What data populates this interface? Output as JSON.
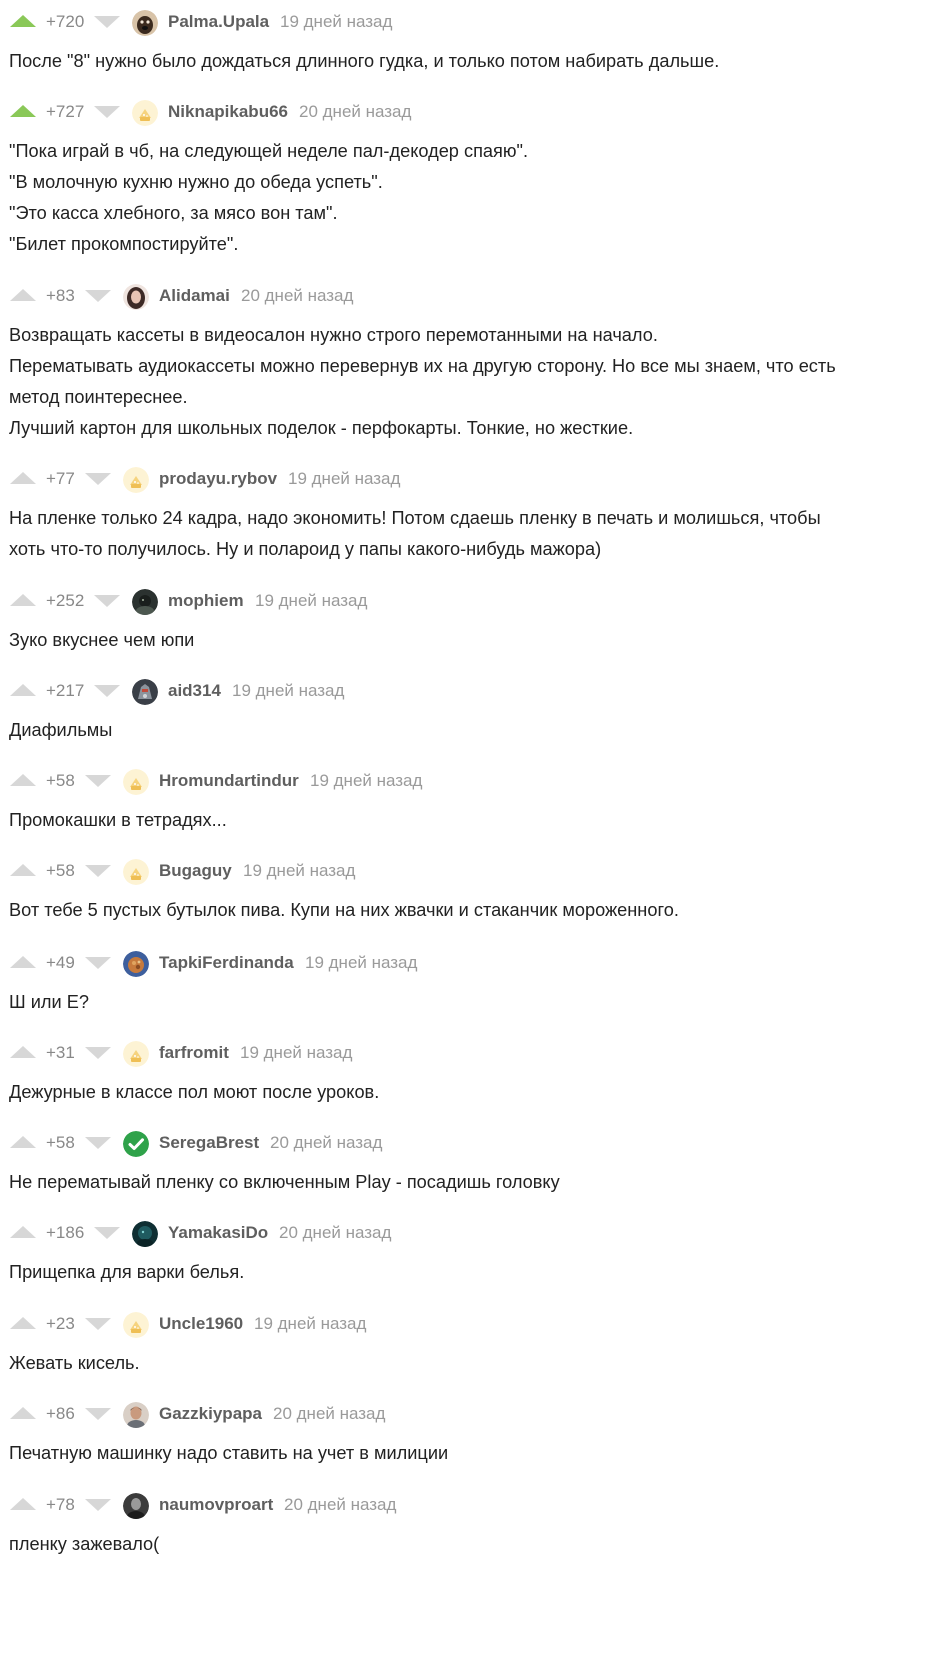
{
  "comments": [
    {
      "rating": "+720",
      "up_active": true,
      "username": "Palma.Upala",
      "time": "19 дней назад",
      "avatar": "dog-avatar",
      "lines": [
        "После \"8\" нужно было дождаться длинного гудка, и только потом набирать дальше."
      ]
    },
    {
      "rating": "+727",
      "up_active": true,
      "username": "Niknapikabu66",
      "time": "20 дней назад",
      "avatar": "default-avatar",
      "lines": [
        "\"Пока играй в чб, на следующей неделе пал-декодер спаяю\".",
        "\"В молочную кухню нужно до обеда успеть\".",
        "\"Это касса хлебного, за мясо вон там\".",
        "\"Билет прокомпостируйте\"."
      ]
    },
    {
      "rating": "+83",
      "up_active": false,
      "username": "Alidamai",
      "time": "20 дней назад",
      "avatar": "girl-avatar",
      "lines": [
        "Возвращать кассеты в видеосалон нужно строго перемотанными на начало.",
        "Перематывать аудиокассеты можно перевернув их на другую сторону. Но все мы знаем, что есть",
        "метод поинтереснее.",
        "Лучший картон для школьных поделок - перфокарты. Тонкие, но жесткие."
      ]
    },
    {
      "rating": "+77",
      "up_active": false,
      "username": "prodayu.rybov",
      "time": "19 дней назад",
      "avatar": "default-avatar",
      "lines": [
        "На пленке только 24 кадра, надо экономить! Потом сдаешь пленку в печать и молишься, чтобы",
        "хоть что-то получилось. Ну и полароид у папы какого-нибудь мажора)"
      ]
    },
    {
      "rating": "+252",
      "up_active": false,
      "username": "mophiem",
      "time": "19 дней назад",
      "avatar": "dark-avatar",
      "lines": [
        "Зуко вкуснее чем юпи"
      ]
    },
    {
      "rating": "+217",
      "up_active": false,
      "username": "aid314",
      "time": "19 дней назад",
      "avatar": "armor-avatar",
      "lines": [
        "Диафильмы"
      ]
    },
    {
      "rating": "+58",
      "up_active": false,
      "username": "Hromundartindur",
      "time": "19 дней назад",
      "avatar": "default-avatar",
      "lines": [
        "Промокашки в тетрадях..."
      ]
    },
    {
      "rating": "+58",
      "up_active": false,
      "username": "Bugaguy",
      "time": "19 дней назад",
      "avatar": "default-avatar",
      "lines": [
        "Вот тебе 5 пустых бутылок пива. Купи на них жвачки и стаканчик мороженного."
      ]
    },
    {
      "rating": "+49",
      "up_active": false,
      "username": "TapkiFerdinanda",
      "time": "19 дней назад",
      "avatar": "food-avatar",
      "lines": [
        "Ш или Е?"
      ]
    },
    {
      "rating": "+31",
      "up_active": false,
      "username": "farfromit",
      "time": "19 дней назад",
      "avatar": "default-avatar",
      "lines": [
        "Дежурные в классе пол моют после уроков."
      ]
    },
    {
      "rating": "+58",
      "up_active": false,
      "username": "SeregaBrest",
      "time": "20 дней назад",
      "avatar": "checkmark-avatar",
      "lines": [
        "Не перематывай пленку со включенным Play - посадишь головку"
      ]
    },
    {
      "rating": "+186",
      "up_active": false,
      "username": "YamakasiDo",
      "time": "20 дней назад",
      "avatar": "teal-avatar",
      "lines": [
        "Прищепка для варки белья."
      ]
    },
    {
      "rating": "+23",
      "up_active": false,
      "username": "Uncle1960",
      "time": "19 дней назад",
      "avatar": "default-avatar",
      "lines": [
        "Жевать кисель."
      ]
    },
    {
      "rating": "+86",
      "up_active": false,
      "username": "Gazzkiypapa",
      "time": "20 дней назад",
      "avatar": "man-avatar",
      "lines": [
        "Печатную машинку надо ставить на учет в милиции"
      ]
    },
    {
      "rating": "+78",
      "up_active": false,
      "username": "naumovproart",
      "time": "20 дней назад",
      "avatar": "bw-avatar",
      "lines": [
        "пленку зажевало("
      ]
    }
  ]
}
